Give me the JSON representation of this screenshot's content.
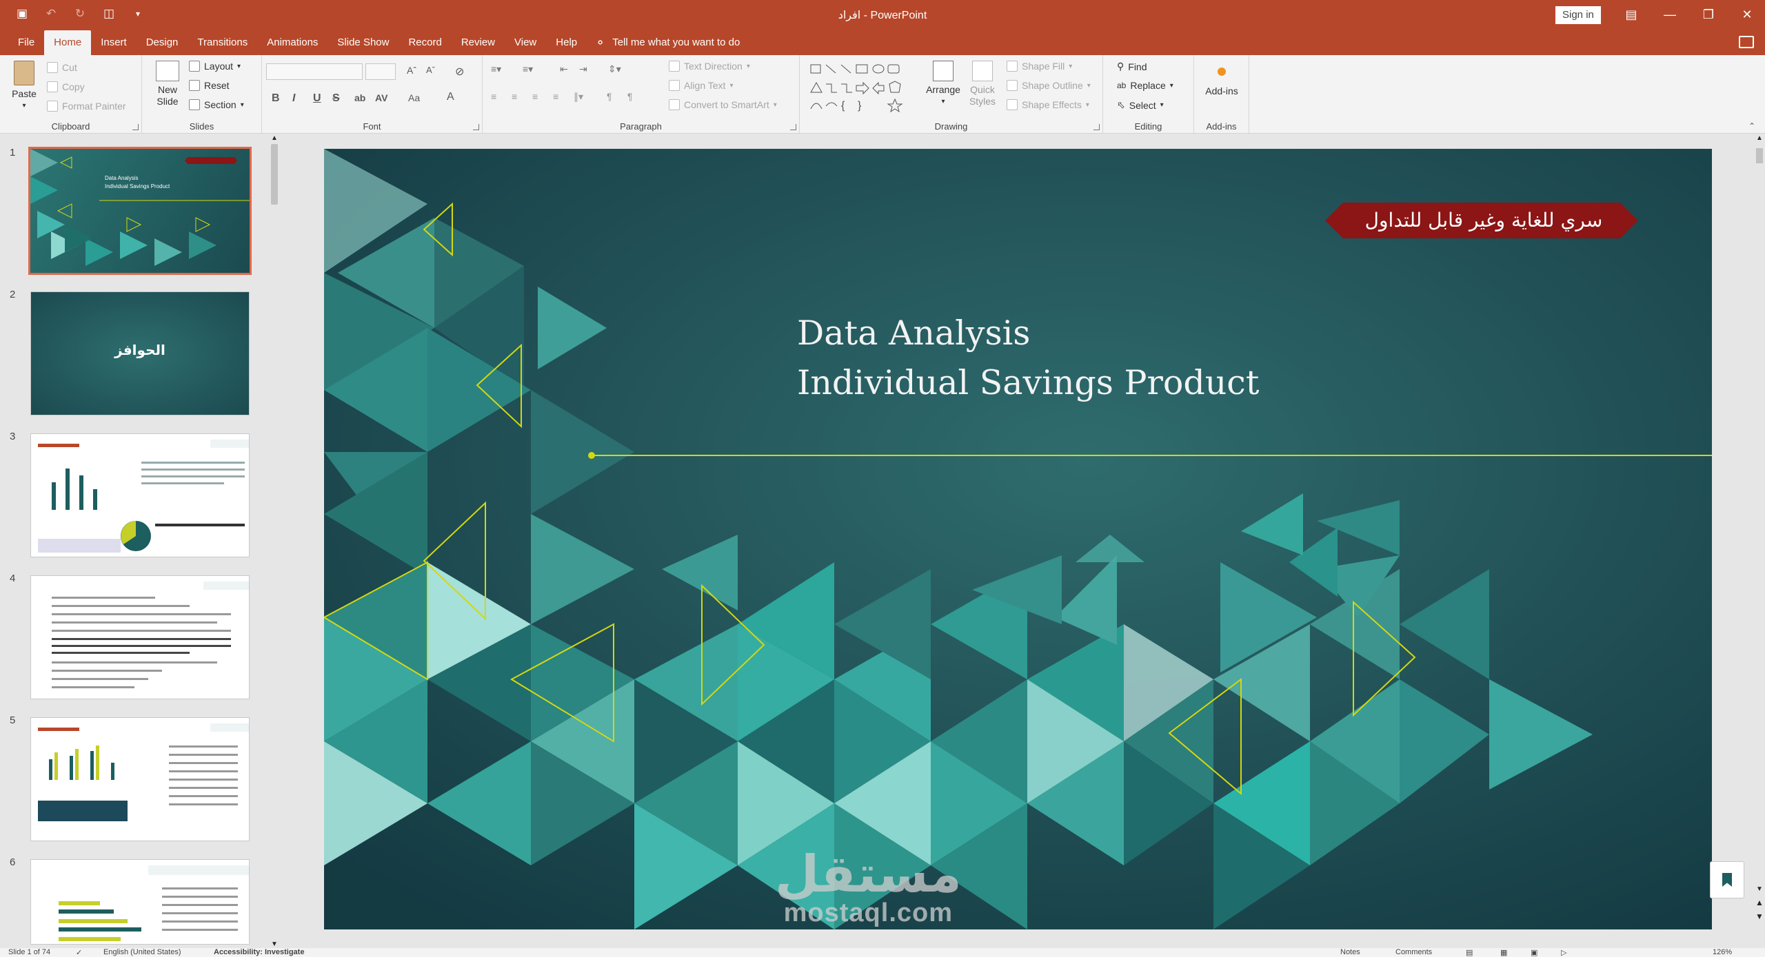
{
  "window": {
    "title": "افراد  -  PowerPoint",
    "sign_in": "Sign in"
  },
  "qat": {
    "save_icon": "save-icon",
    "undo_icon": "undo-icon",
    "redo_icon": "redo-icon",
    "present_icon": "start-from-beginning-icon"
  },
  "tabs": [
    {
      "label": "File"
    },
    {
      "label": "Home",
      "active": true
    },
    {
      "label": "Insert"
    },
    {
      "label": "Design"
    },
    {
      "label": "Transitions"
    },
    {
      "label": "Animations"
    },
    {
      "label": "Slide Show"
    },
    {
      "label": "Record"
    },
    {
      "label": "Review"
    },
    {
      "label": "View"
    },
    {
      "label": "Help"
    }
  ],
  "tell_me": "Tell me what you want to do",
  "ribbon": {
    "clipboard": {
      "label": "Clipboard",
      "paste": "Paste",
      "cut": "Cut",
      "copy": "Copy",
      "format_painter": "Format Painter"
    },
    "slides": {
      "label": "Slides",
      "new_slide_1": "New",
      "new_slide_2": "Slide",
      "layout": "Layout",
      "reset": "Reset",
      "section": "Section"
    },
    "font": {
      "label": "Font"
    },
    "paragraph": {
      "label": "Paragraph",
      "text_direction": "Text Direction",
      "align_text": "Align Text",
      "convert_smartart": "Convert to SmartArt"
    },
    "drawing": {
      "label": "Drawing",
      "arrange": "Arrange",
      "quick_styles_1": "Quick",
      "quick_styles_2": "Styles",
      "shape_fill": "Shape Fill",
      "shape_outline": "Shape Outline",
      "shape_effects": "Shape Effects"
    },
    "editing": {
      "label": "Editing",
      "find": "Find",
      "replace": "Replace",
      "select": "Select"
    },
    "addins": {
      "label": "Add-ins",
      "addins": "Add-ins"
    }
  },
  "slides_panel": {
    "numbers": [
      "1",
      "2",
      "3",
      "4",
      "5",
      "6"
    ],
    "slide2_title": "الحوافز",
    "slide1_title": "Data Analysis",
    "slide1_subtitle": "Individual Savings Product"
  },
  "slide": {
    "title_line1": "Data Analysis",
    "title_line2": "Individual Savings Product",
    "confidential": "سري للغاية وغير قابل للتداول",
    "colors": {
      "bg_dark": "#1b4a4f",
      "accent": "#d4d80f",
      "teal": "#2a9d95",
      "banner": "#8c1515"
    }
  },
  "watermark": {
    "arabic": "مستقل",
    "latin": "mostaql.com"
  },
  "status": {
    "slide_count": "Slide 1 of 74",
    "language": "English (United States)",
    "accessibility": "Accessibility: Investigate",
    "notes": "Notes",
    "comments": "Comments",
    "zoom": "126%"
  }
}
